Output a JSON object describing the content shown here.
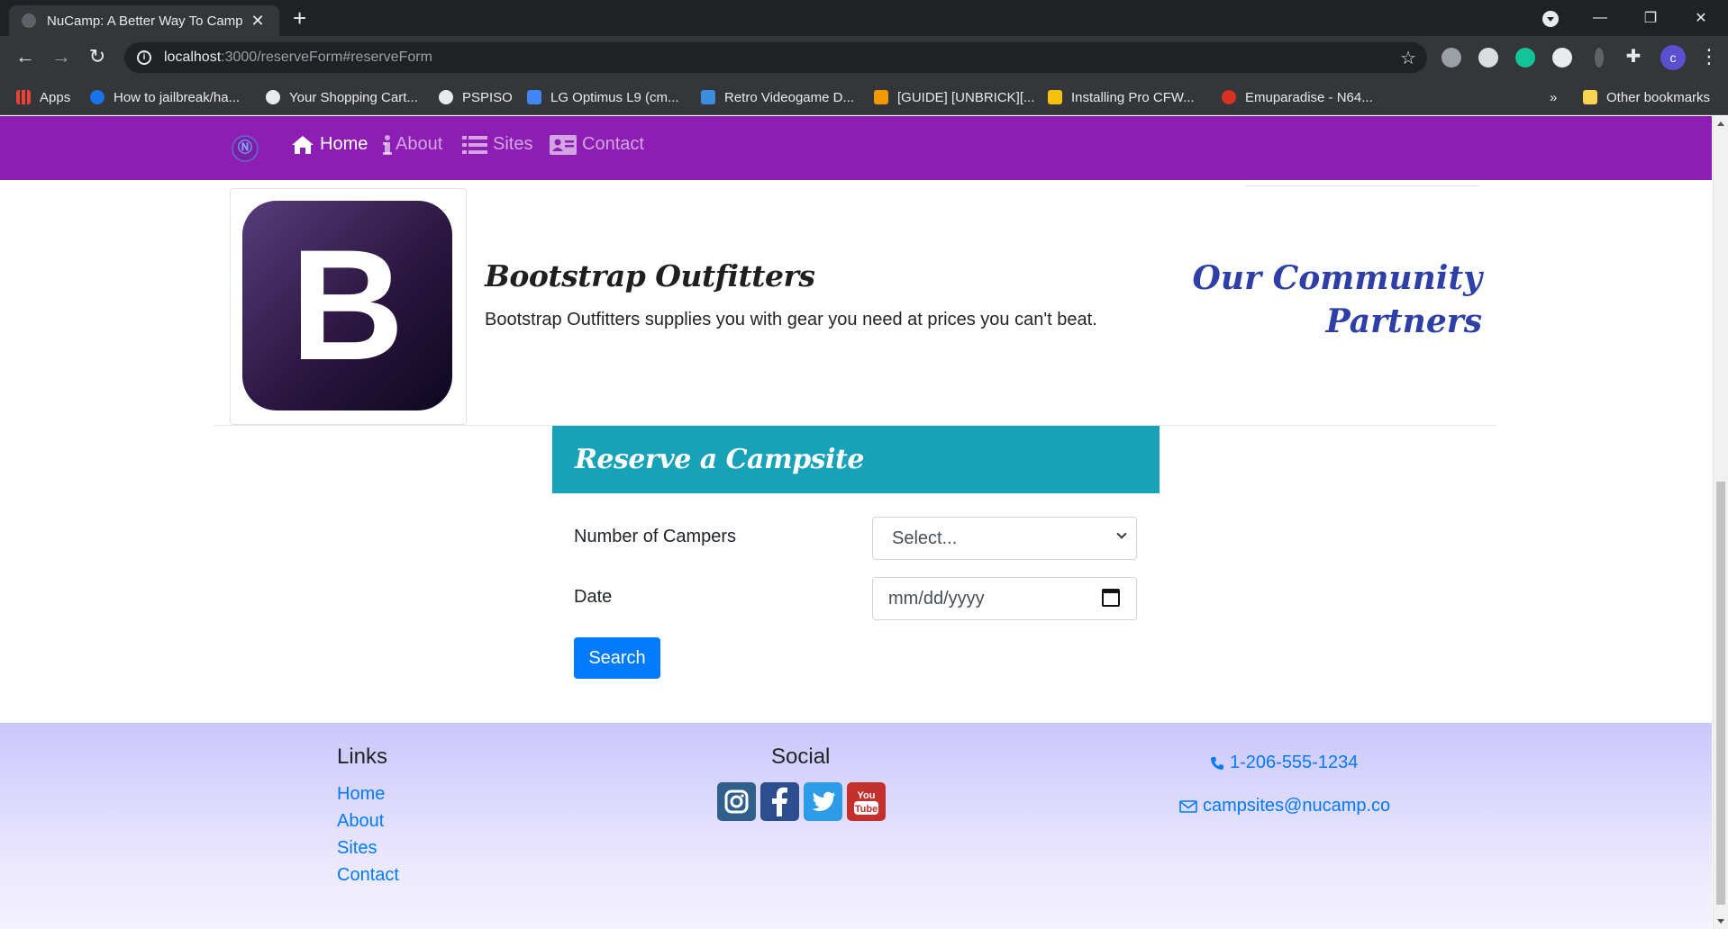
{
  "browser": {
    "tab_title": "NuCamp: A Better Way To Camp",
    "url_host": "localhost",
    "url_path": ":3000/reserveForm#reserveForm",
    "profile_initial": "c",
    "bookmarks": [
      {
        "label": "Apps",
        "color": "#ea4335"
      },
      {
        "label": "How to jailbreak/ha...",
        "color": "#1a73e8"
      },
      {
        "label": "Your Shopping Cart...",
        "color": "#e8eaed"
      },
      {
        "label": "PSPISO",
        "color": "#e8eaed"
      },
      {
        "label": "LG Optimus L9 (cm...",
        "color": "#4285f4"
      },
      {
        "label": "Retro Videogame D...",
        "color": "#3c8dde"
      },
      {
        "label": "[GUIDE] [UNBRICK][...",
        "color": "#f29900"
      },
      {
        "label": "Installing Pro CFW...",
        "color": "#f4c20d"
      },
      {
        "label": "Emuparadise - N64...",
        "color": "#d93025"
      }
    ],
    "other_bookmarks": "Other bookmarks",
    "overflow": "»"
  },
  "nav": {
    "items": [
      {
        "label": "Home",
        "icon": "home-icon"
      },
      {
        "label": "About",
        "icon": "info-icon"
      },
      {
        "label": "Sites",
        "icon": "list-icon"
      },
      {
        "label": "Contact",
        "icon": "address-card-icon"
      }
    ]
  },
  "partner": {
    "logo_letter": "B",
    "name": "Bootstrap Outfitters",
    "description": "Bootstrap Outfitters supplies you with gear you need at prices you can't beat."
  },
  "community_heading_line1": "Our Community",
  "community_heading_line2": "Partners",
  "reserve": {
    "title": "Reserve a Campsite",
    "campers_label": "Number of Campers",
    "campers_value": "Select...",
    "date_label": "Date",
    "date_placeholder": "mm/dd/yyyy",
    "search_label": "Search"
  },
  "footer": {
    "links_heading": "Links",
    "links": [
      "Home",
      "About",
      "Sites",
      "Contact"
    ],
    "social_heading": "Social",
    "social": [
      {
        "name": "instagram-icon",
        "color": "#2f5f8a"
      },
      {
        "name": "facebook-icon",
        "color": "#2c4d8e"
      },
      {
        "name": "twitter-icon",
        "color": "#2d9be8"
      },
      {
        "name": "youtube-icon",
        "color": "#c4302b"
      }
    ],
    "phone": "1-206-555-1234",
    "email": "campsites@nucamp.co"
  },
  "colors": {
    "navbar": "#8e1db4",
    "reserve_header": "#17a2b8",
    "primary": "#007bff",
    "community_heading": "#2f3fa8"
  }
}
